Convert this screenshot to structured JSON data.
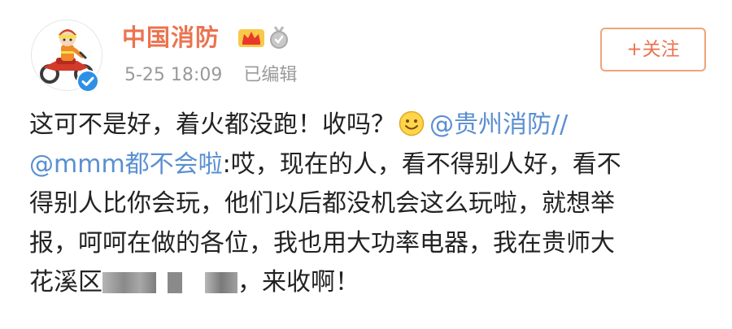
{
  "post": {
    "username": "中国消防",
    "timestamp": "5-25 18:09",
    "edited_label": "已编辑",
    "follow_label": "+关注",
    "body": {
      "line1_text": "这可不是好，着火都没跑！收吗？",
      "line1_mention": "@贵州消防",
      "line1_slashes": "//",
      "line2_mention": "@mmm都不会啦",
      "line2_text": ":哎，现在的人，看不得别人好，看不",
      "line3_text": "得别人比你会玩，他们以后都没机会这么玩啦，就想举",
      "line4_text": "报，呵呵在做的各位，我也用大功率电器，我在贵师大",
      "line5_prefix": "花溪区",
      "line5_suffix": "，来收啊！"
    }
  },
  "icons": {
    "avatar": "firefighter-on-motorcycle-avatar",
    "verified": "verified-check-badge",
    "crown": "vip-crown-icon",
    "medal": "medal-icon",
    "emoji": "smile-emoji"
  },
  "colors": {
    "username": "#eb7350",
    "mention": "#5a8fd1",
    "meta": "#9a9a9a",
    "body_text": "#222222",
    "follow_border": "#f0a47a",
    "verified_badge": "#2e8fe6"
  }
}
